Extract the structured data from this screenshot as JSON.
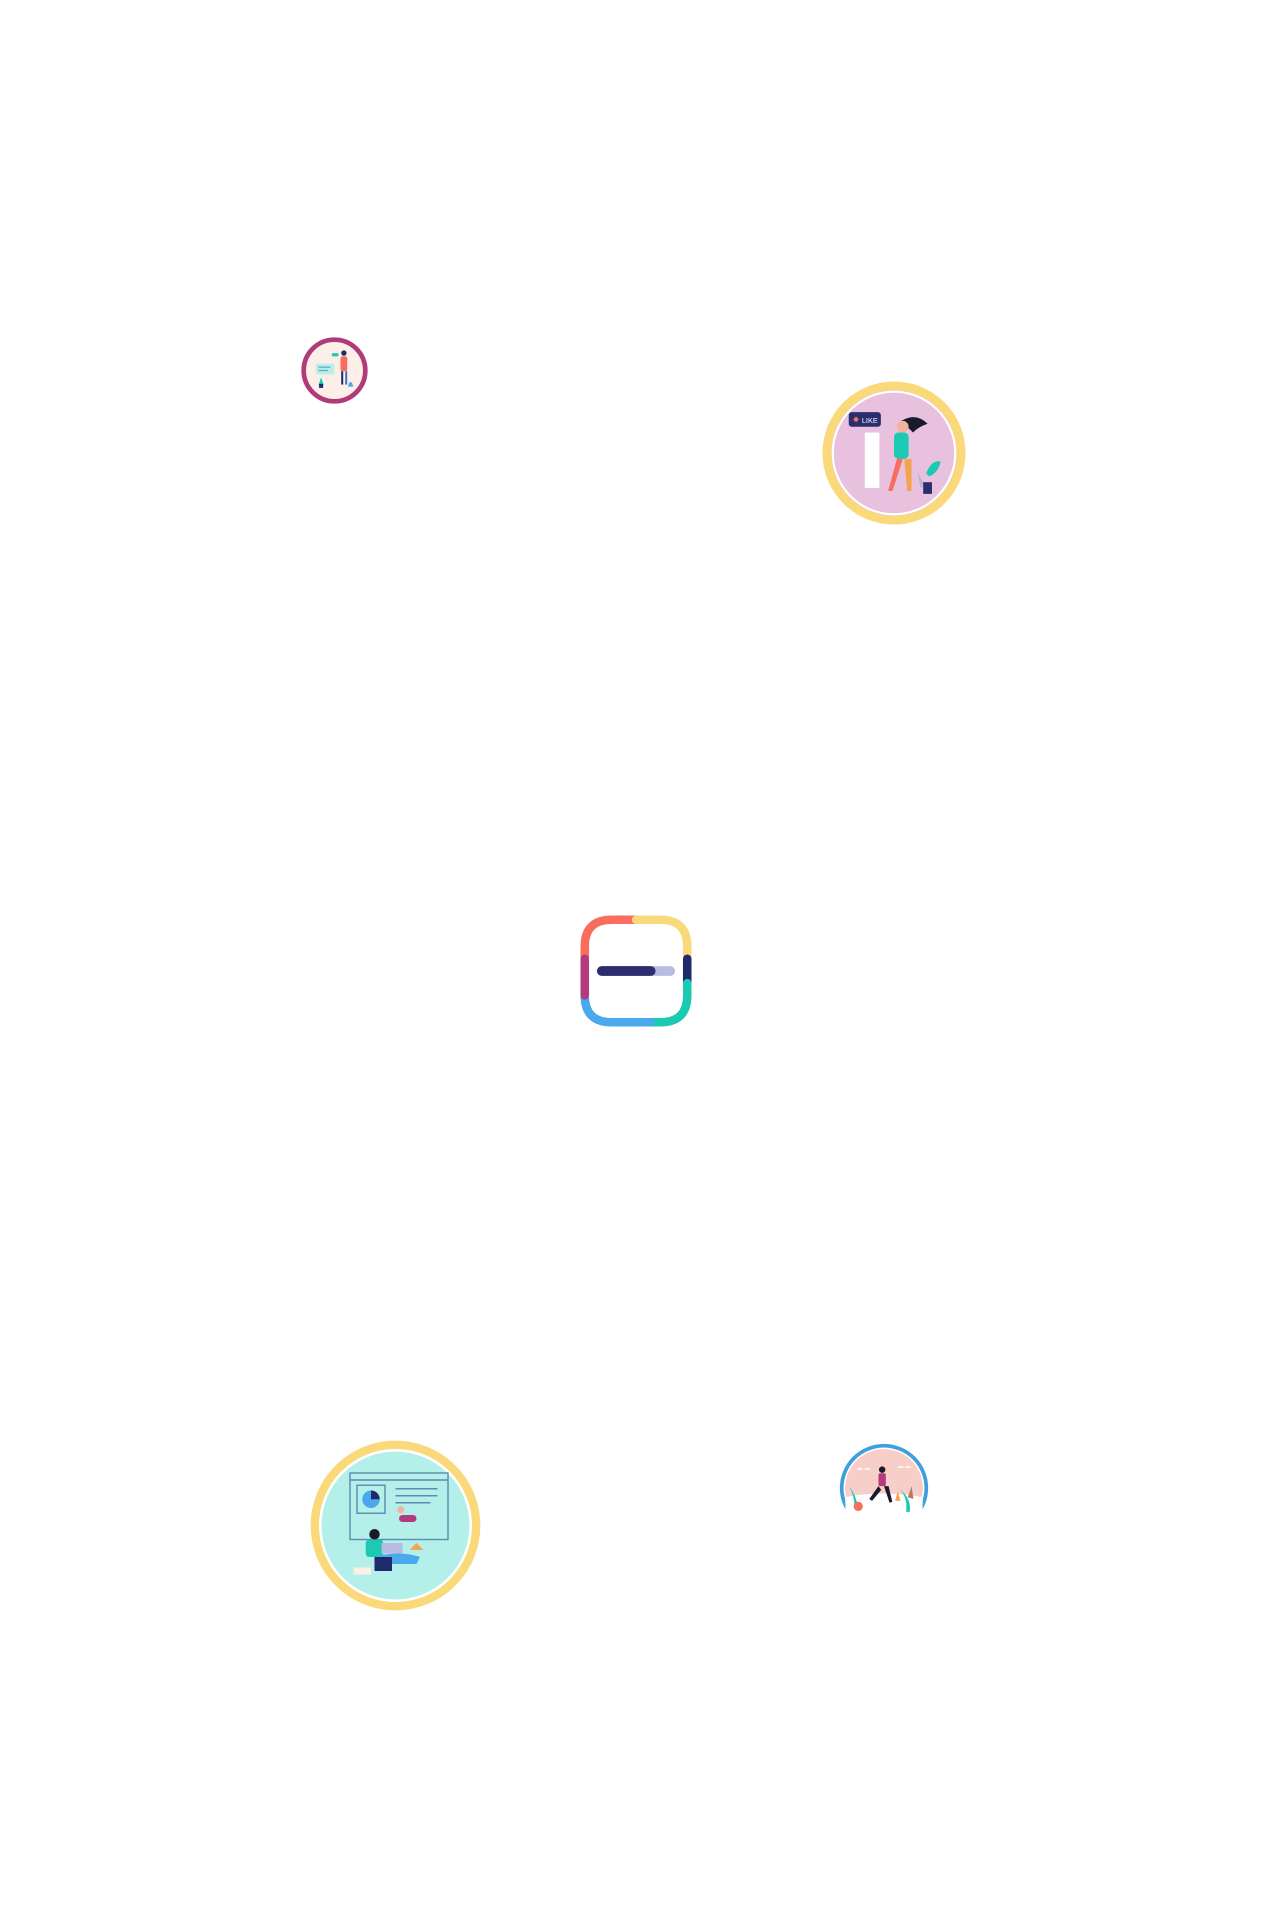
{
  "bubbles": [
    {
      "name": "illustration-bubble-team",
      "icon": "people-collaboration-illustration",
      "ring_color": "#B03A7A",
      "fill_color": "#FCEFE8"
    },
    {
      "name": "illustration-bubble-like",
      "icon": "woman-like-illustration",
      "ring_color": "#FAD97A",
      "fill_color": "#E8C1DE",
      "badge_text": "LIKE"
    },
    {
      "name": "illustration-bubble-analytics",
      "icon": "person-laptop-chart-illustration",
      "ring_color": "#FAD97A",
      "fill_color": "#B4F0E9"
    },
    {
      "name": "illustration-bubble-runner",
      "icon": "runner-illustration",
      "ring_color": "#3FA0E0",
      "fill_color": "#F7CFC8"
    }
  ],
  "loader": {
    "icon": "colorful-loading-icon",
    "colors": [
      "#F96D5F",
      "#FAD97A",
      "#1F2A6D",
      "#1CC9B2",
      "#4AA8EC",
      "#B43A7F"
    ],
    "progress": 0.75
  }
}
